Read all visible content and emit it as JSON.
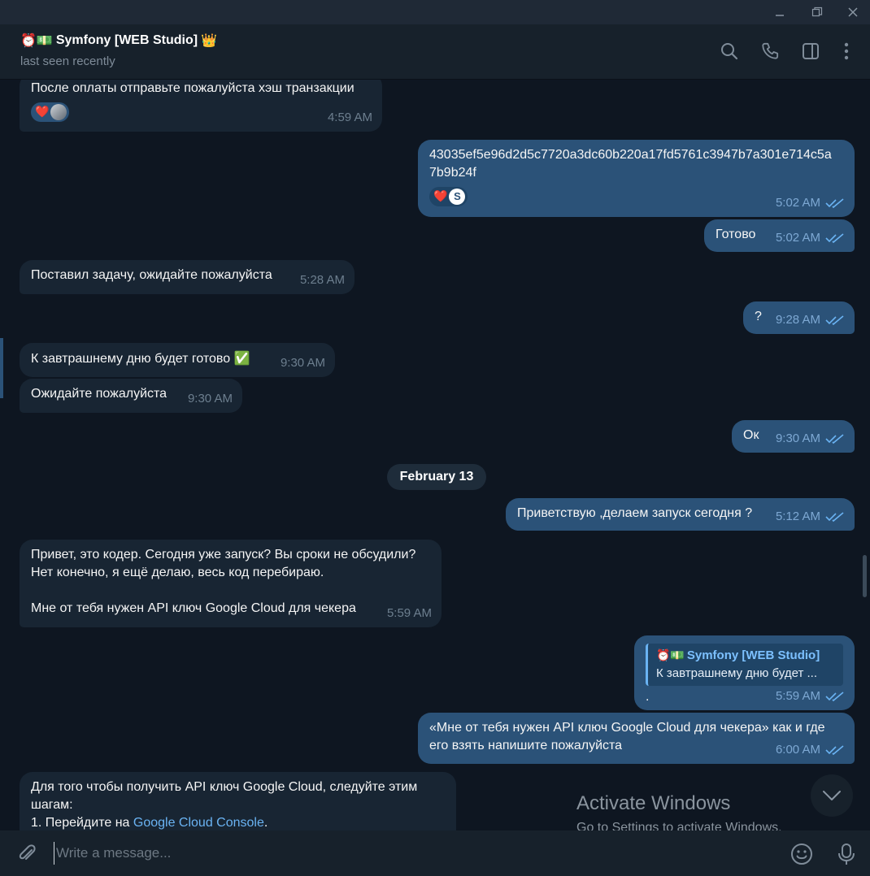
{
  "window": {
    "minimize_icon": "minimize-icon",
    "restore_icon": "restore-icon",
    "close_icon": "close-icon"
  },
  "header": {
    "title_prefix": "⏰💵",
    "title": "Symfony [WEB Studio]",
    "title_suffix": "👑",
    "status": "last seen recently",
    "icons": [
      "search-icon",
      "phone-icon",
      "sidebar-toggle-icon",
      "more-vertical-icon"
    ]
  },
  "messages": {
    "m1": {
      "text": "После оплаты отправьте пожалуйста хэш транзакции",
      "time": "4:59 AM",
      "reaction": "❤️"
    },
    "m2": {
      "text_line1": "43035ef5e96d2d5c7720a3dc60b220a17fd5761c3947b7a301e714c5a",
      "text_line2": "7b9b24f",
      "time": "5:02 AM",
      "reaction": "❤️",
      "reactor_letter": "S"
    },
    "m3": {
      "text": "Готово",
      "time": "5:02 AM"
    },
    "m4": {
      "text": "Поставил задачу, ожидайте пожалуйста",
      "time": "5:28 AM"
    },
    "m5": {
      "text": "?",
      "time": "9:28 AM"
    },
    "m6": {
      "text": "К завтрашнему дню будет готово",
      "emoji": "✅",
      "time": "9:30 AM"
    },
    "m7": {
      "text": "Ожидайте пожалуйста",
      "time": "9:30 AM"
    },
    "m8": {
      "text": "Ок",
      "time": "9:30 AM"
    },
    "date_separator": "February 13",
    "m9": {
      "text": "Приветствую ,делаем запуск сегодня ?",
      "time": "5:12 AM"
    },
    "m10": {
      "line1": "Привет, это кодер. Сегодня уже запуск? Вы сроки не обсудили?",
      "line2": "Нет конечно, я ещё делаю, весь код перебираю.",
      "line3": "Мне от тебя нужен API ключ Google Cloud для чекера",
      "time": "5:59 AM"
    },
    "m11": {
      "reply_prefix": "⏰💵",
      "reply_name": "Symfony [WEB Studio]",
      "reply_text": "К завтрашнему дню будет ...",
      "text": ".",
      "time": "5:59 AM"
    },
    "m12": {
      "line1": "«Мне от тебя нужен API ключ Google Cloud для чекера» как и где",
      "line2": "его взять напишите пожалуйста",
      "time": "6:00 AM"
    },
    "m13": {
      "line1": "Для того чтобы получить API ключ Google Cloud, следуйте этим",
      "line2": "шагам:",
      "step_prefix": "1. Перейдите на ",
      "step_link": "Google Cloud Console",
      "step_suffix": "."
    }
  },
  "watermark": {
    "line1": "Activate Windows",
    "line2": "Go to Settings to activate Windows."
  },
  "composer": {
    "placeholder": "Write a message...",
    "icons": [
      "attach-icon",
      "emoji-icon",
      "microphone-icon"
    ]
  },
  "colors": {
    "background": "#0e1621",
    "incoming_bubble": "#182533",
    "outgoing_bubble": "#2b5278",
    "header": "#17212b",
    "accent": "#6ab3f3"
  }
}
